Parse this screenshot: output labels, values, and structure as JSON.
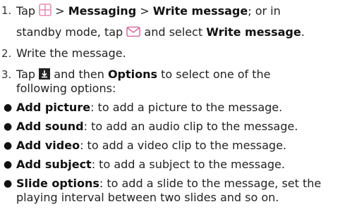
{
  "colors": {
    "menu_icon": "#e58fb4",
    "envelope_icon": "#d96fa3",
    "download_icon": "#222222"
  },
  "icons": [
    "menu-grid-icon",
    "envelope-icon",
    "download-icon"
  ],
  "steps": [
    {
      "number": "1.",
      "part1": "Tap ",
      "sep1": " > ",
      "b1": "Messaging",
      "sep2": " > ",
      "b2": "Write message",
      "part2": "; or in",
      "part3": "standby mode, tap ",
      "part4": " and select ",
      "b3": "Write message",
      "part5": "."
    },
    {
      "number": "2.",
      "text": "Write the message."
    },
    {
      "number": "3.",
      "part1": "Tap ",
      "part2": " and then ",
      "b1": "Options",
      "part3": " to select one of the",
      "part4": "following options:"
    }
  ],
  "options": [
    {
      "label": "Add picture",
      "desc": ": to add a picture to the message."
    },
    {
      "label": "Add sound",
      "desc": ": to add an audio clip to the message."
    },
    {
      "label": "Add video",
      "desc": ": to add a video clip to the message."
    },
    {
      "label": "Add subject",
      "desc": ": to add a subject to the message."
    },
    {
      "label": "Slide options",
      "desc": ": to add a slide to the message, set the",
      "desc2": "playing interval between two slides and so on."
    }
  ]
}
